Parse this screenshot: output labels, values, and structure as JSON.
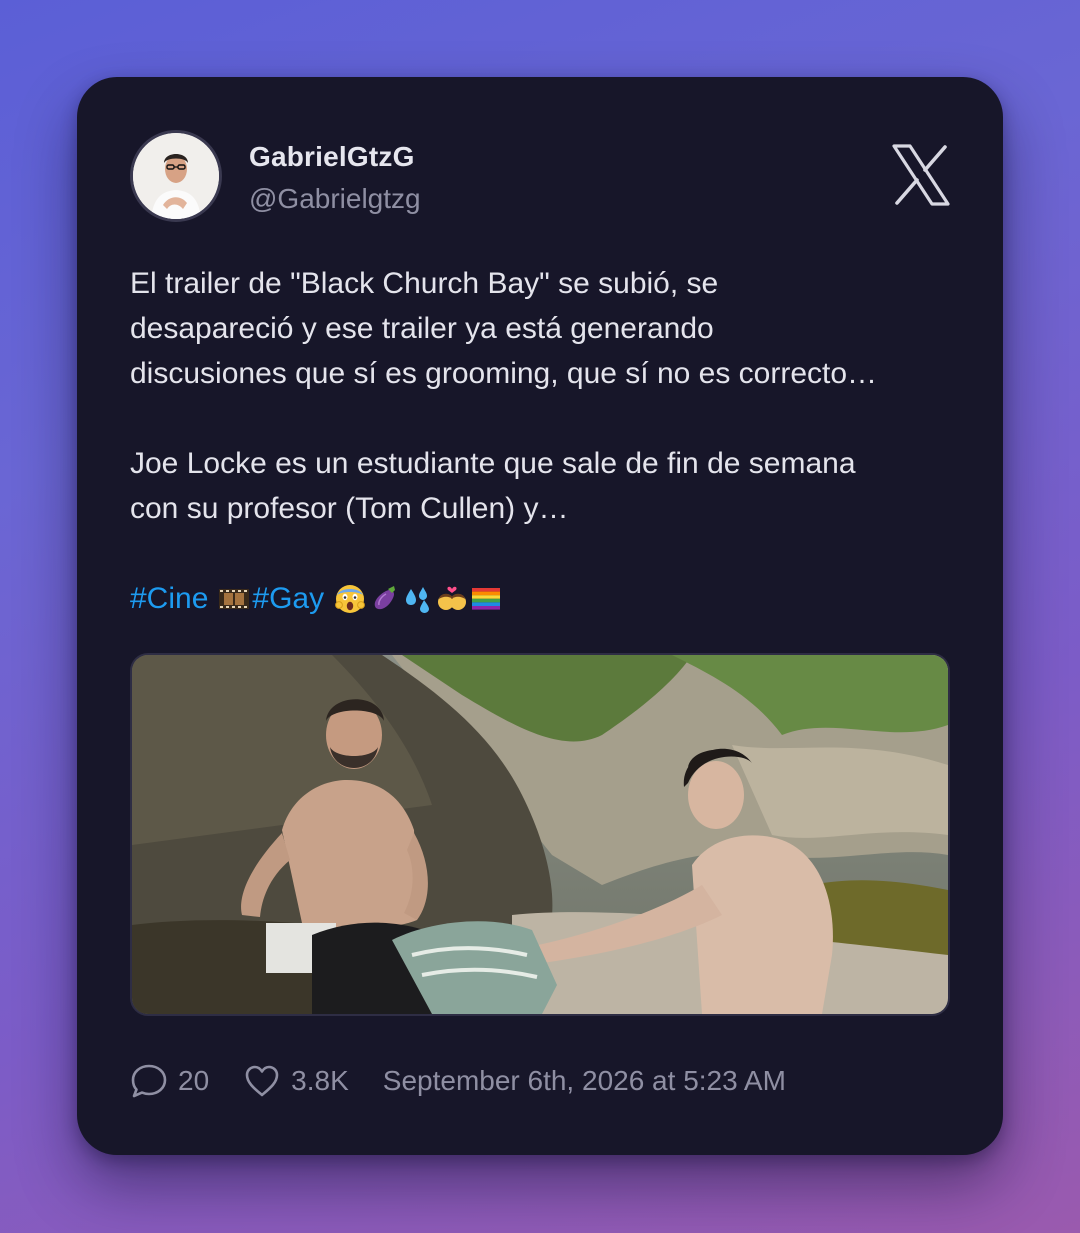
{
  "author": {
    "display_name": "GabrielGtzG",
    "handle": "@Gabrielgtzg",
    "avatar_icon": "profile-photo-man-glasses-white-shirt"
  },
  "platform_icon": "x-logo-icon",
  "tweet": {
    "lines_p1": [
      "El trailer de \"Black Church Bay\" se subió, se",
      "desapareció y ese trailer ya está generando",
      "discusiones que sí es grooming, que sí no es correcto…"
    ],
    "lines_p2": [
      "Joe Locke es un estudiante que sale de fin de semana",
      "con su profesor (Tom Cullen) y…"
    ],
    "hashtag_1": "#Cine",
    "hashtag_2": "#Gay",
    "emojis": [
      "film-frames-emoji",
      "screaming-face-emoji",
      "eggplant-emoji",
      "sweat-droplets-emoji",
      "kiss-couple-emoji",
      "rainbow-flag-emoji"
    ]
  },
  "media": {
    "description_icon": "photo-two-shirtless-men-on-rocky-beach"
  },
  "stats": {
    "replies": "20",
    "likes": "3.8K",
    "timestamp": "September 6th, 2026 at 5:23 AM"
  },
  "colors": {
    "card_bg": "#171629",
    "hashtag": "#1d9bf0",
    "text_primary": "#e4e4ec",
    "text_secondary": "#8f8fa3"
  }
}
